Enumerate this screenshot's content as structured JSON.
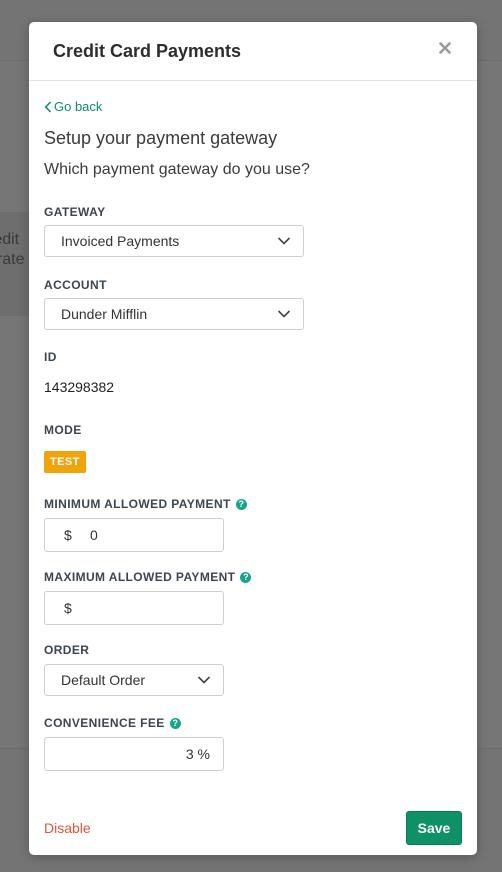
{
  "background": {
    "card_text_lines": [
      "redit",
      "grate"
    ]
  },
  "modal": {
    "title": "Credit Card Payments",
    "close_icon": "close-icon",
    "go_back": "Go back",
    "subtitle": "Setup your payment gateway",
    "question": "Which payment gateway do you use?",
    "gateway": {
      "label": "GATEWAY",
      "selected": "Invoiced Payments"
    },
    "account": {
      "label": "ACCOUNT",
      "selected": "Dunder Mifflin"
    },
    "id": {
      "label": "ID",
      "value": "143298382"
    },
    "mode": {
      "label": "MODE",
      "badge": "TEST",
      "badge_color": "#f0a30a"
    },
    "min_payment": {
      "label": "MINIMUM ALLOWED PAYMENT",
      "prefix": "$",
      "value": "0"
    },
    "max_payment": {
      "label": "MAXIMUM ALLOWED PAYMENT",
      "prefix": "$",
      "value": ""
    },
    "order": {
      "label": "ORDER",
      "selected": "Default Order"
    },
    "convenience_fee": {
      "label": "CONVENIENCE FEE",
      "value": "3",
      "suffix": "%"
    },
    "help_icon_glyph": "?",
    "disable_label": "Disable",
    "save_label": "Save",
    "colors": {
      "accent": "#0e9166",
      "link": "#0a8f6a",
      "danger": "#e0553a",
      "help": "#17a589"
    }
  }
}
